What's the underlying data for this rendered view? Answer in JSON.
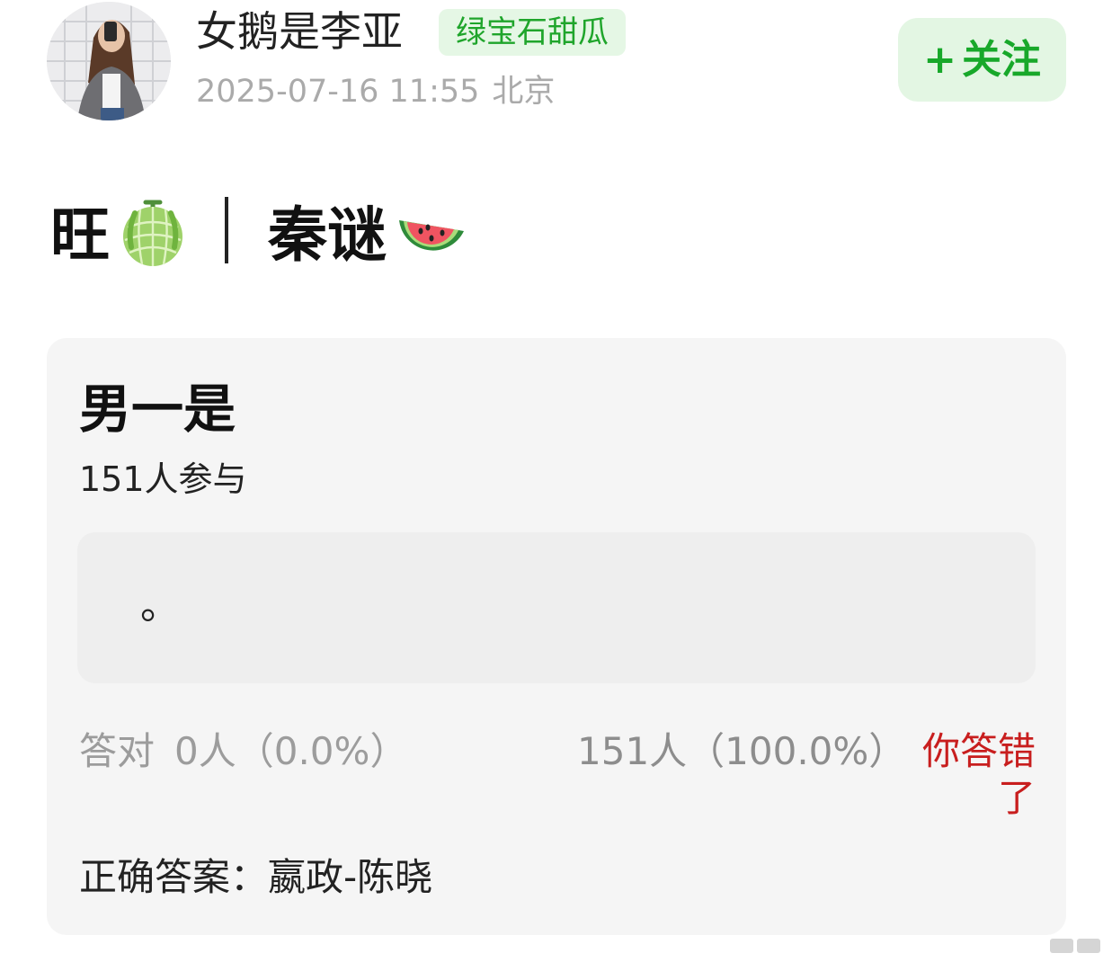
{
  "post": {
    "author": {
      "name": "女鹅是李亚",
      "badge": "绿宝石甜瓜",
      "avatar_icon": "avatar-photo"
    },
    "timestamp": "2025-07-16 11:55",
    "location": "北京",
    "follow_label": "关注",
    "follow_icon": "+",
    "content": {
      "text_left": "旺",
      "text_right": "秦谜",
      "emoji_left": "melon-emoji",
      "emoji_right": "watermelon-emoji"
    }
  },
  "quiz": {
    "question": "男一是",
    "participants": "151人参与",
    "user_answer": "。",
    "correct_label": "答对",
    "correct_stat": "0人（0.0%）",
    "wrong_stat": "151人（100.0%）",
    "result_message": "你答错了",
    "correct_answer": "正确答案：嬴政-陈晓"
  },
  "colors": {
    "accent_green": "#1fa52b",
    "badge_bg": "#e5f7e5",
    "error_red": "#c81e1e",
    "card_bg": "#f5f5f5"
  }
}
